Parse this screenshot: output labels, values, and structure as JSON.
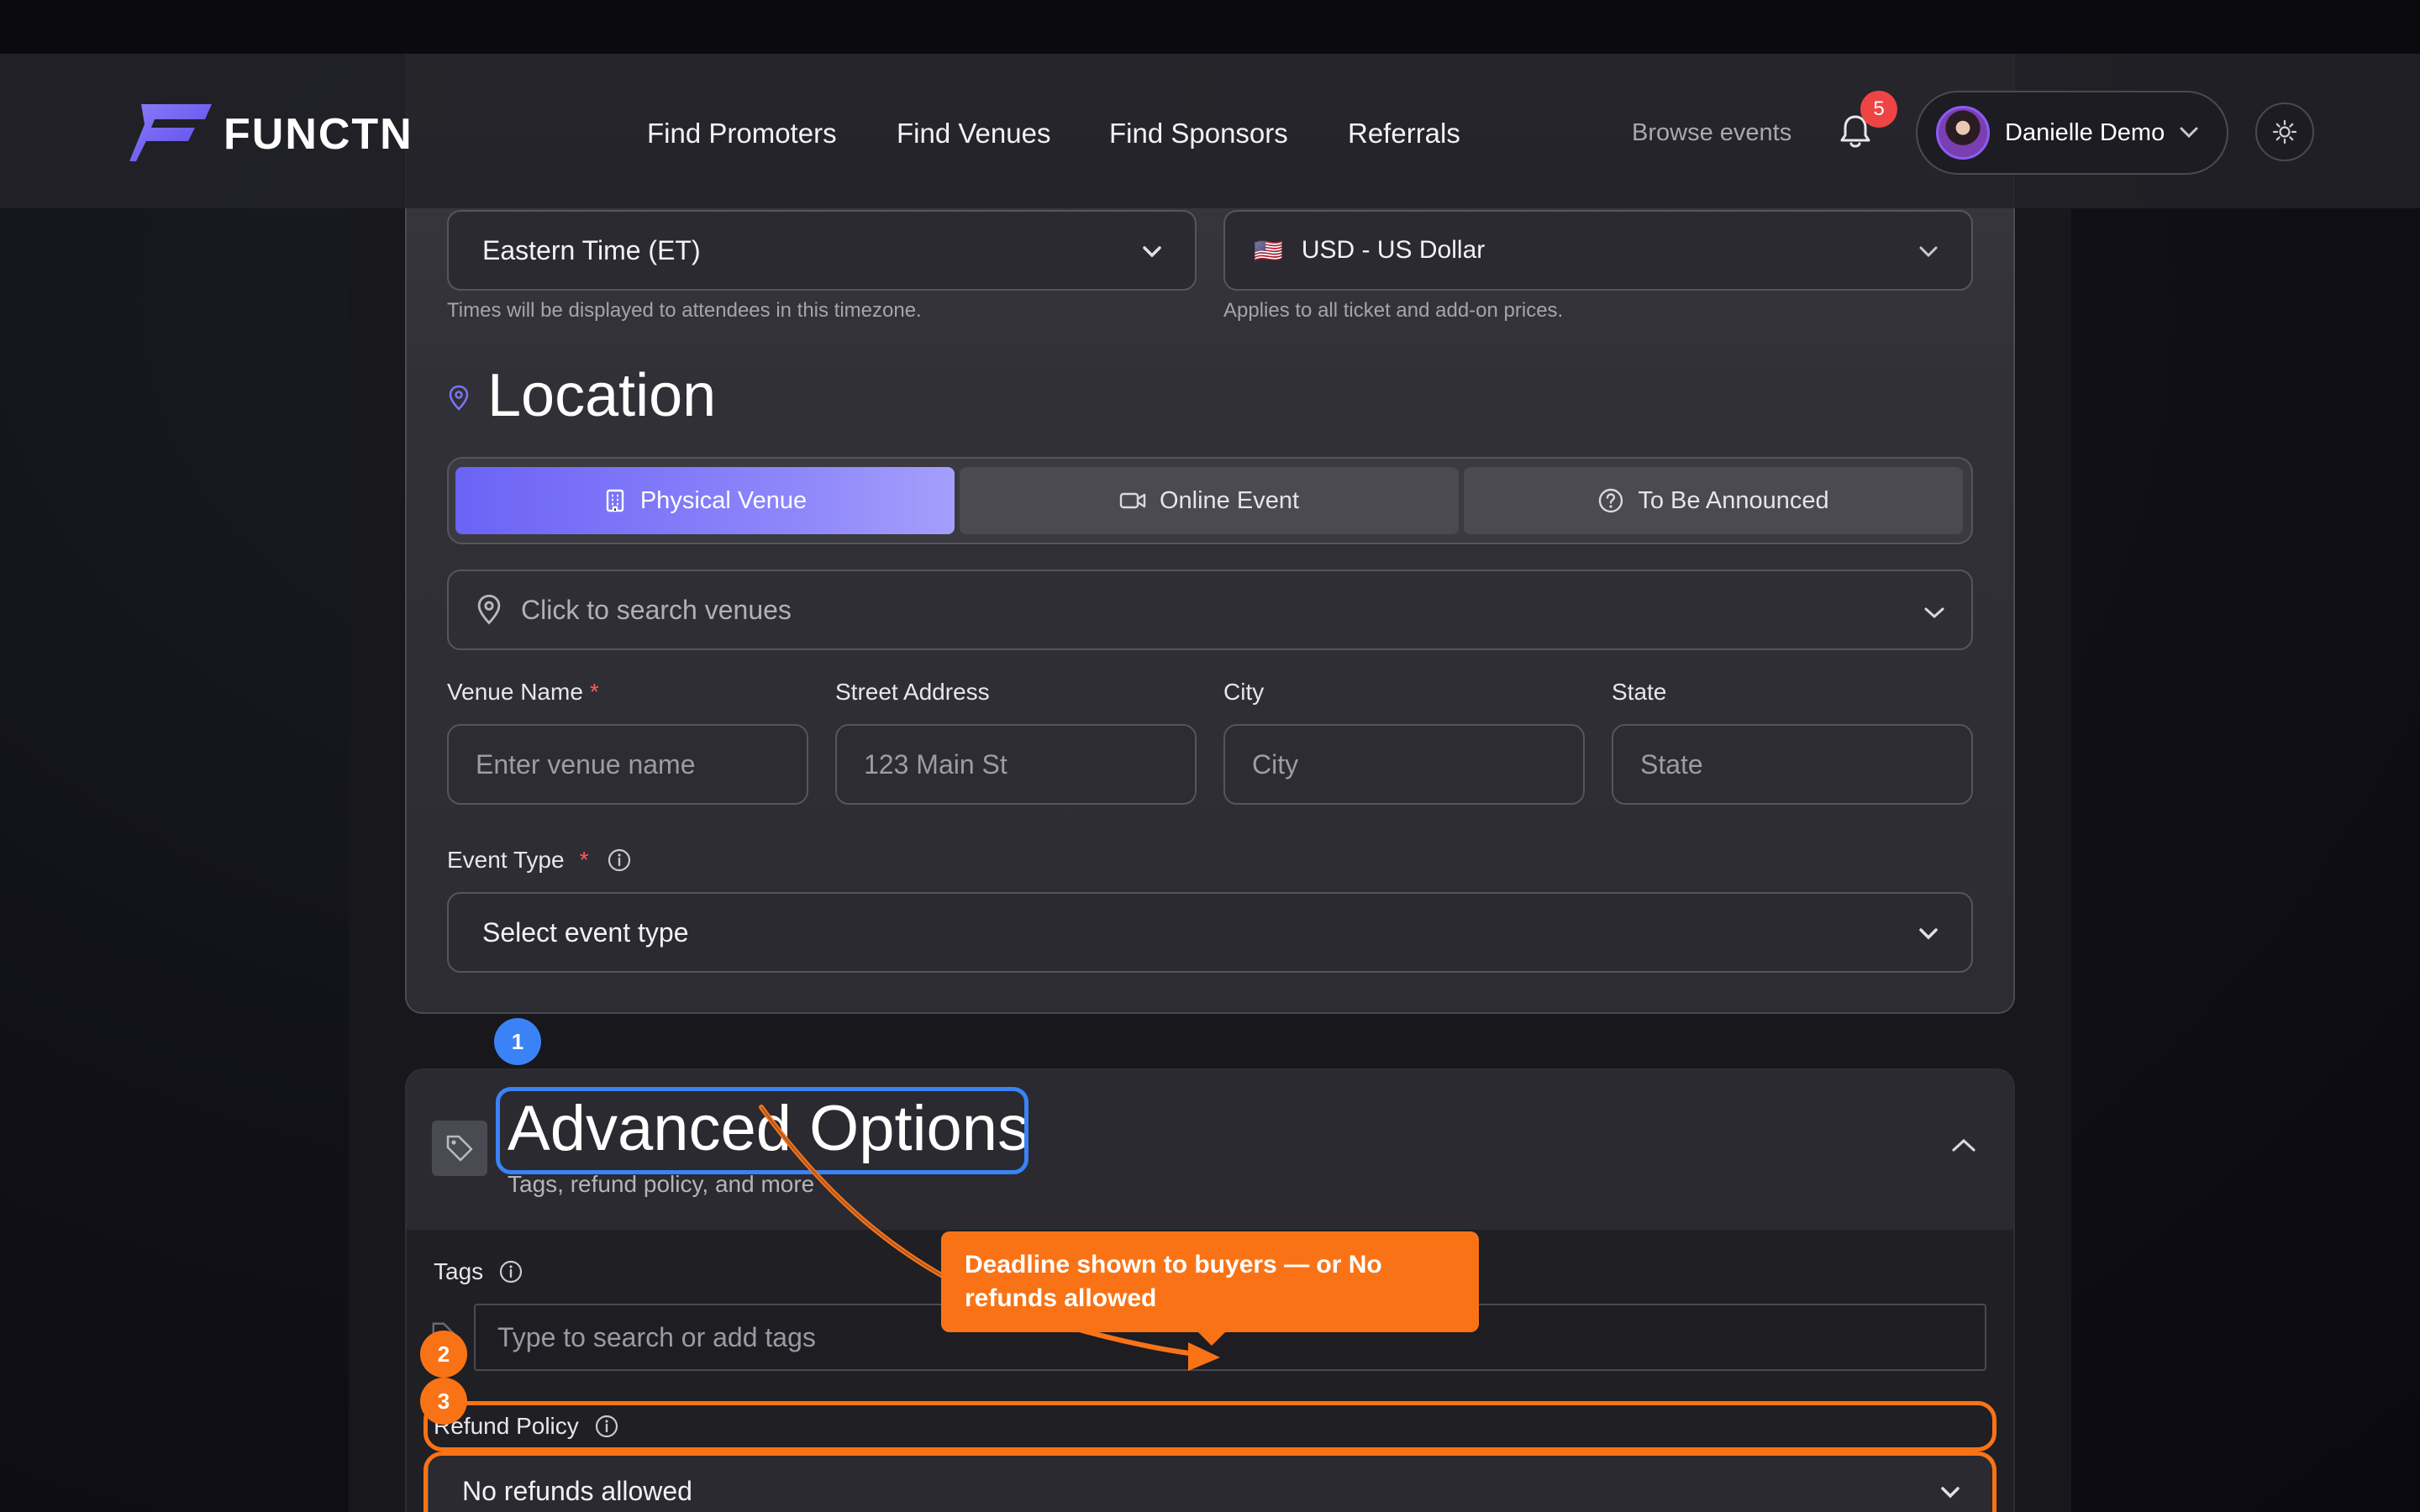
{
  "header": {
    "brand": "FUNCTN",
    "nav": [
      {
        "label": "Find Promoters"
      },
      {
        "label": "Find Venues"
      },
      {
        "label": "Find Sponsors"
      },
      {
        "label": "Referrals"
      }
    ],
    "browse_label": "Browse events",
    "notification_count": "5",
    "user_name": "Danielle Demo"
  },
  "event_form": {
    "timezone": {
      "value": "Eastern Time (ET)",
      "hint": "Times will be displayed to attendees in this timezone."
    },
    "currency": {
      "flag": "🇺🇸",
      "value": "USD - US Dollar",
      "hint": "Applies to all ticket and add-on prices."
    },
    "location": {
      "title": "Location",
      "tabs": [
        {
          "label": "Physical Venue",
          "icon": "building-icon",
          "active": true
        },
        {
          "label": "Online Event",
          "icon": "video-icon",
          "active": false
        },
        {
          "label": "To Be Announced",
          "icon": "help-circle-icon",
          "active": false
        }
      ],
      "venue_search_placeholder": "Click to search venues",
      "fields": [
        {
          "label": "Venue Name",
          "required": "*",
          "placeholder": "Enter venue name"
        },
        {
          "label": "Street Address",
          "placeholder": "123 Main St"
        },
        {
          "label": "City",
          "placeholder": "City"
        },
        {
          "label": "State",
          "placeholder": "State"
        }
      ]
    },
    "event_type": {
      "label": "Event Type",
      "required": "*",
      "value": "Select event type"
    }
  },
  "advanced": {
    "title": "Advanced Options",
    "subtitle": "Tags, refund policy, and more",
    "tags_label": "Tags",
    "tags_placeholder": "Type to search or add tags",
    "refund_label": "Refund Policy",
    "refund_value": "No refunds allowed"
  },
  "annotations": {
    "steps": [
      "1",
      "2",
      "3"
    ],
    "tooltip": "Deadline shown to buyers — or No refunds allowed",
    "colors": {
      "blue": "#3b82f6",
      "orange": "#f97316"
    }
  },
  "colors": {
    "accent": "#6b63f5",
    "required": "#ff5a5a",
    "notification": "#ef4444"
  }
}
